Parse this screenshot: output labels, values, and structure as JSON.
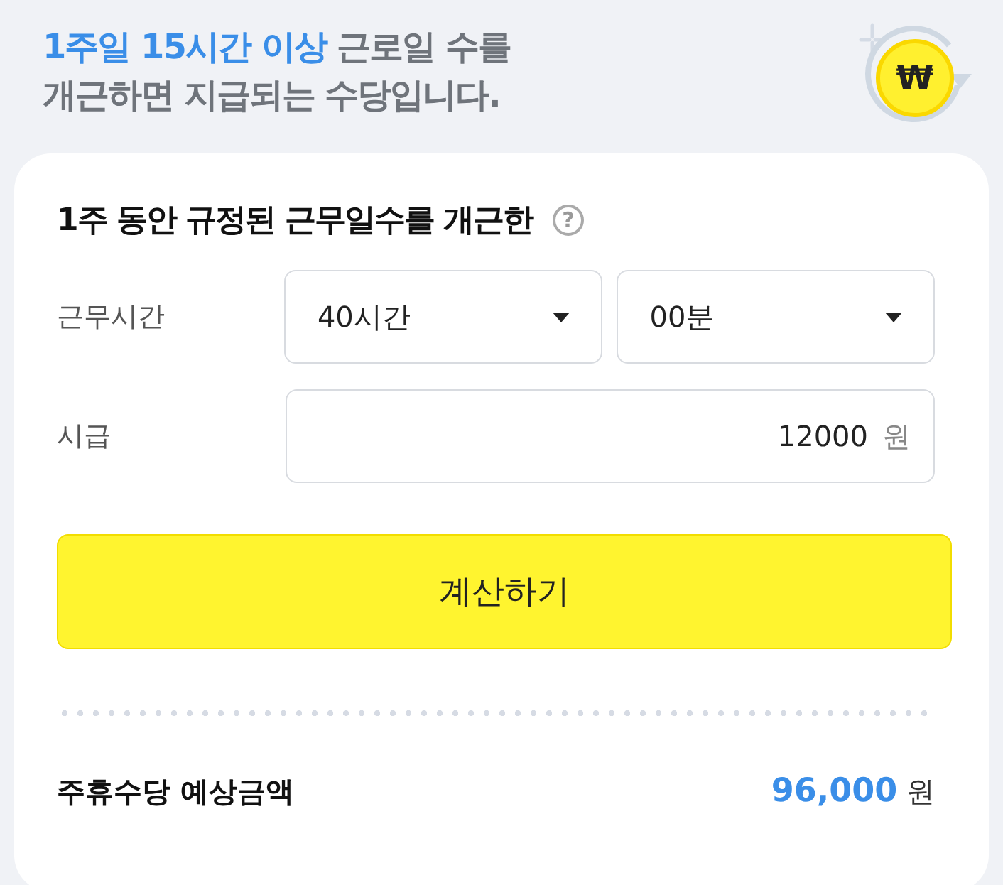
{
  "headline": {
    "highlight": "1주일 15시간 이상",
    "line1_rest": "근로일 수를",
    "line2": "개근하면 지급되는 수당입니다."
  },
  "coin": {
    "symbol": "₩"
  },
  "card": {
    "title": "1주 동안 규정된 근무일수를 개근한",
    "help": "?"
  },
  "hours": {
    "label": "근무시간",
    "hour_value": "40시간",
    "minute_value": "00분"
  },
  "wage": {
    "label": "시급",
    "value": "12000",
    "unit": "원"
  },
  "calculate_button": "계산하기",
  "result": {
    "label": "주휴수당 예상금액",
    "amount": "96,000",
    "unit": "원"
  }
}
